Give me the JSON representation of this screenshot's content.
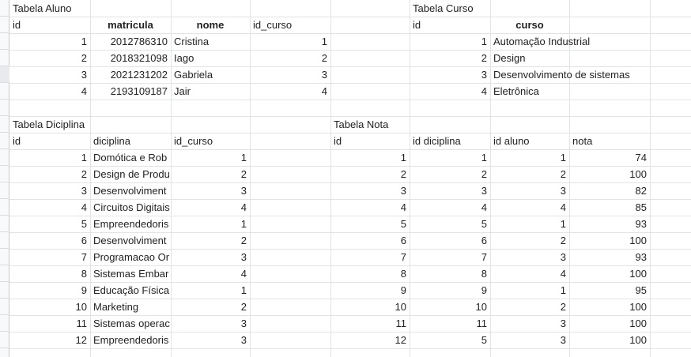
{
  "tables": {
    "aluno": {
      "title": "Tabela Aluno",
      "headers": [
        "id",
        "matricula",
        "nome",
        "id_curso"
      ],
      "rows": [
        [
          "1",
          "2012786310",
          "Cristina",
          "1"
        ],
        [
          "2",
          "2018321098",
          "Iago",
          "2"
        ],
        [
          "3",
          "2021231202",
          "Gabriela",
          "3"
        ],
        [
          "4",
          "2193109187",
          "Jair",
          "4"
        ]
      ]
    },
    "curso": {
      "title": "Tabela Curso",
      "headers": [
        "id",
        "curso"
      ],
      "rows": [
        [
          "1",
          "Automação Industrial"
        ],
        [
          "2",
          "Design"
        ],
        [
          "3",
          "Desenvolvimento de sistemas"
        ],
        [
          "4",
          "Eletrônica"
        ]
      ]
    },
    "diciplina": {
      "title": "Tabela Diciplina",
      "headers": [
        "id",
        "diciplina",
        "id_curso"
      ],
      "rows": [
        [
          "1",
          "Domótica e Rob",
          "1"
        ],
        [
          "2",
          "Design de Produ",
          "2"
        ],
        [
          "3",
          "Desenvolviment",
          "3"
        ],
        [
          "4",
          "Circuitos Digitais",
          "4"
        ],
        [
          "5",
          "Empreendedoris",
          "1"
        ],
        [
          "6",
          "Desenvolviment",
          "2"
        ],
        [
          "7",
          "Programacao Or",
          "3"
        ],
        [
          "8",
          "Sistemas Embar",
          "4"
        ],
        [
          "9",
          "Educação Física",
          "1"
        ],
        [
          "10",
          "Marketing",
          "2"
        ],
        [
          "11",
          "Sistemas operac",
          "3"
        ],
        [
          "12",
          "Empreendedoris",
          "3"
        ]
      ]
    },
    "nota": {
      "title": "Tabela Nota",
      "headers": [
        "id",
        "id diciplina",
        "id aluno",
        "nota"
      ],
      "rows": [
        [
          "1",
          "1",
          "1",
          "74"
        ],
        [
          "2",
          "2",
          "2",
          "100"
        ],
        [
          "3",
          "3",
          "3",
          "82"
        ],
        [
          "4",
          "4",
          "4",
          "85"
        ],
        [
          "5",
          "5",
          "1",
          "93"
        ],
        [
          "6",
          "6",
          "2",
          "100"
        ],
        [
          "7",
          "7",
          "3",
          "93"
        ],
        [
          "8",
          "8",
          "4",
          "100"
        ],
        [
          "9",
          "9",
          "1",
          "95"
        ],
        [
          "10",
          "10",
          "2",
          "100"
        ],
        [
          "11",
          "11",
          "3",
          "100"
        ],
        [
          "12",
          "5",
          "3",
          "100"
        ]
      ]
    }
  },
  "colors": {
    "gridline": "#e2e3e3",
    "row_header_bg": "#f8f9fa",
    "selected_row_header": "#e8eaed"
  }
}
